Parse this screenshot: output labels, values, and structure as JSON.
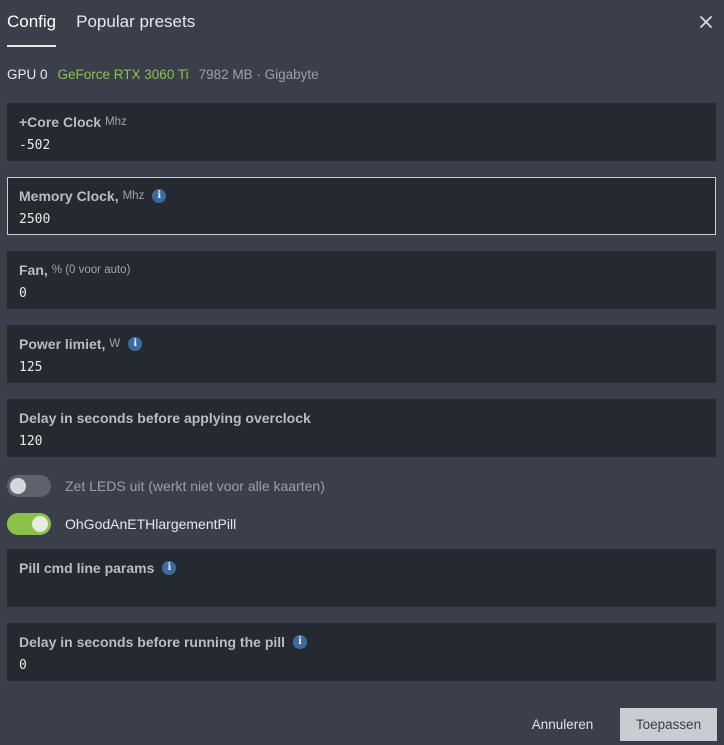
{
  "tabs": [
    {
      "label": "Config",
      "active": true
    },
    {
      "label": "Popular presets",
      "active": false
    }
  ],
  "gpu": {
    "id": "GPU 0",
    "name": "GeForce RTX 3060 Ti",
    "meta": "7982 MB · Gigabyte"
  },
  "fields": {
    "core_clock": {
      "label": "+Core Clock",
      "unit": "Mhz",
      "value": "-502",
      "info": false
    },
    "memory_clock": {
      "label": "Memory Clock,",
      "unit": "Mhz",
      "value": "2500",
      "info": true
    },
    "fan": {
      "label": "Fan,",
      "unit": "% (0 voor auto)",
      "value": "0",
      "info": false
    },
    "power_limit": {
      "label": "Power limiet,",
      "unit": "W",
      "value": "125",
      "info": true
    },
    "oc_delay": {
      "label": "Delay in seconds before applying overclock",
      "unit": "",
      "value": "120",
      "info": false
    },
    "pill_params": {
      "label": "Pill cmd line params",
      "unit": "",
      "value": "",
      "info": true
    },
    "pill_delay": {
      "label": "Delay in seconds before running the pill",
      "unit": "",
      "value": "0",
      "info": true
    }
  },
  "toggles": {
    "leds_off": {
      "label": "Zet LEDS uit (werkt niet voor alle kaarten)",
      "on": false
    },
    "pill": {
      "label": "OhGodAnETHlargementPill",
      "on": true
    }
  },
  "info_glyph": "i",
  "buttons": {
    "cancel": "Annuleren",
    "apply": "Toepassen"
  },
  "colors": {
    "background": "#3a3f4b",
    "field_background": "#252930",
    "accent_green": "#8bc34a",
    "info_blue": "#3d6a9e"
  },
  "icons": {
    "close": "close-icon",
    "info": "info-icon"
  }
}
